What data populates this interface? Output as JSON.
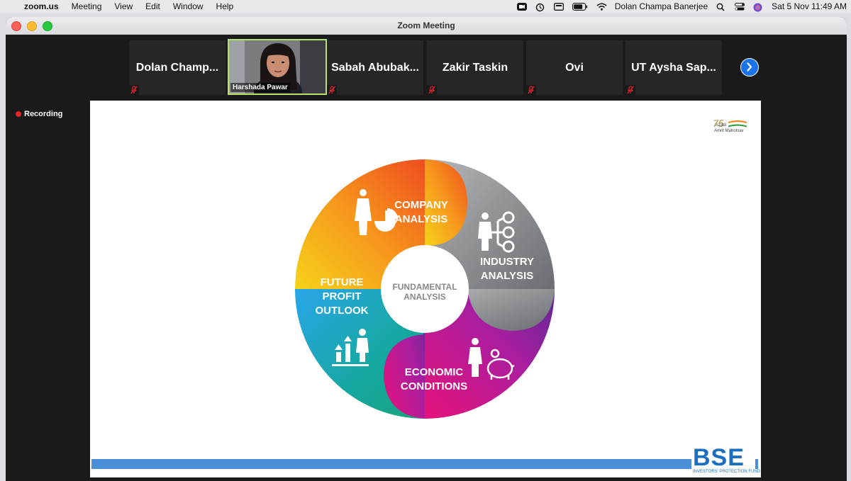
{
  "menubar": {
    "app_name": "zoom.us",
    "items": [
      "Meeting",
      "View",
      "Edit",
      "Window",
      "Help"
    ],
    "user_name": "Dolan Champa Banerjee",
    "datetime": "Sat 5 Nov  11:49 AM"
  },
  "window": {
    "title": "Zoom Meeting"
  },
  "participants": [
    {
      "name": "Dolan Champ..."
    },
    {
      "name": "Harshada Pawar",
      "video": true
    },
    {
      "name": "Sabah Abubak..."
    },
    {
      "name": "Zakir Taskin"
    },
    {
      "name": "Ovi"
    },
    {
      "name": "UT Aysha Sap..."
    }
  ],
  "recording_label": "Recording",
  "slide": {
    "center": [
      "FUNDAMENTAL",
      "ANALYSIS"
    ],
    "segments": {
      "company": [
        "COMPANY",
        "ANALYSIS"
      ],
      "industry": [
        "INDUSTRY",
        "ANALYSIS"
      ],
      "economic": [
        "ECONOMIC",
        "CONDITIONS"
      ],
      "future": [
        "FUTURE",
        "PROFIT",
        "OUTLOOK"
      ]
    },
    "azadi": {
      "num": "75",
      "line1": "Azadi",
      "line2": "Amrit Mahotsav"
    },
    "bse": {
      "logo": "BSE",
      "sub": "INVESTORS' PROTECTION FUND"
    }
  },
  "colors": {
    "accent_blue": "#1a73e8",
    "active_border": "#b8e06a",
    "recording_red": "#e0242a"
  }
}
